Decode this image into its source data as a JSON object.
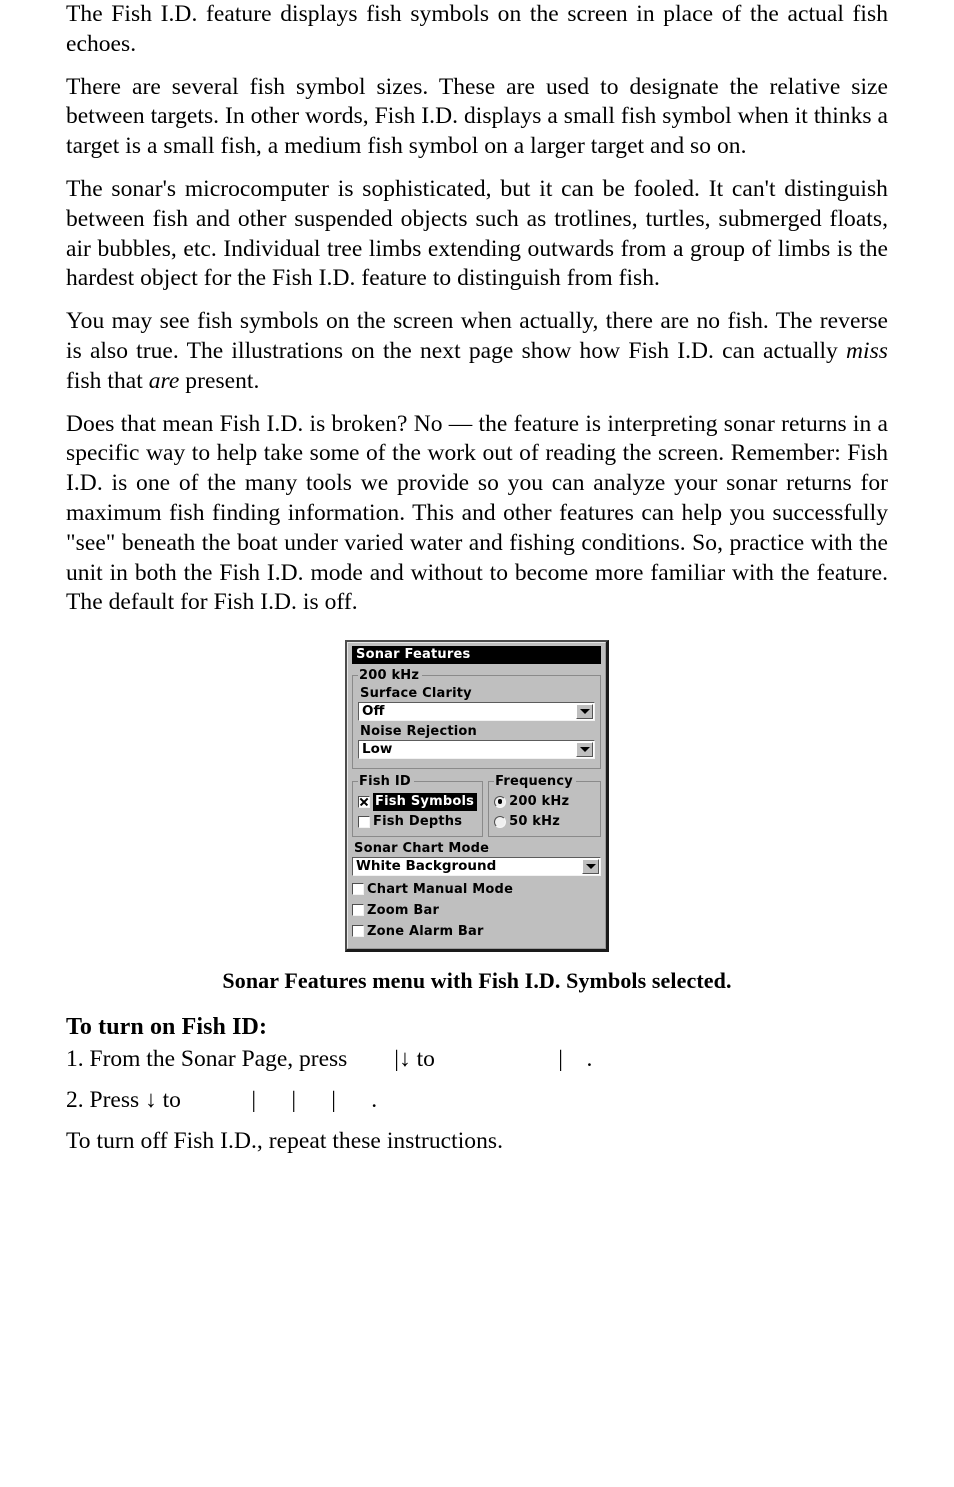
{
  "document": {
    "paragraphs": [
      "The Fish I.D. feature displays fish symbols on the screen in place of the actual fish echoes.",
      "There are several fish symbol sizes. These are used to designate the relative size between targets. In other words, Fish I.D. displays a small fish symbol when it thinks a target is a small fish, a medium fish symbol on a larger target and so on.",
      "The sonar's microcomputer is sophisticated, but it can be fooled. It can't distinguish between fish and other suspended objects such as trotlines, turtles, submerged floats, air bubbles, etc. Individual tree limbs extending outwards from a group of limbs is the hardest object for the Fish I.D. feature to distinguish from fish."
    ],
    "paragraph_4": {
      "part1": "You may see fish symbols on the screen when actually, there are no fish. The reverse is also true. The illustrations on the next page show how Fish I.D. can actually ",
      "italic1": "miss",
      "part2": " fish that ",
      "italic2": "are",
      "part3": " present."
    },
    "paragraph_5": "Does that mean Fish I.D. is broken? No — the feature is interpreting sonar returns in a specific way to help take some of the work out of reading the screen. Remember: Fish I.D. is one of the many tools we provide so you can analyze your sonar returns for maximum fish finding information. This and other features can help you successfully \"see\" beneath the boat under varied water and fishing conditions. So, practice with the unit in both the Fish I.D. mode and without to become more familiar with the feature. The default for Fish I.D. is off.",
    "figure_caption": "Sonar Features menu with Fish I.D. Symbols selected.",
    "instructions_heading": "To turn on Fish ID:",
    "step_1": "1. From the Sonar Page, press        |↓ to                     |    .",
    "step_2": "2. Press ↓ to            |      |      |      .",
    "closing": "To turn off Fish I.D., repeat these instructions."
  },
  "dialog": {
    "title": "Sonar Features",
    "group_200khz": {
      "legend": "200 kHz",
      "surface_clarity": {
        "label": "Surface Clarity",
        "value": "Off"
      },
      "noise_rejection": {
        "label": "Noise Rejection",
        "value": "Low"
      }
    },
    "group_fish_id": {
      "legend": "Fish ID",
      "options": [
        {
          "label": "Fish Symbols",
          "checked": true,
          "highlighted": true
        },
        {
          "label": "Fish Depths",
          "checked": false,
          "highlighted": false
        }
      ]
    },
    "group_frequency": {
      "legend": "Frequency",
      "options": [
        {
          "label": "200 kHz",
          "selected": true
        },
        {
          "label": "50 kHz",
          "selected": false
        }
      ]
    },
    "sonar_chart_mode": {
      "label": "Sonar Chart Mode",
      "value": "White Background"
    },
    "bottom_checkboxes": [
      {
        "label": "Chart Manual Mode",
        "checked": false
      },
      {
        "label": "Zoom Bar",
        "checked": false
      },
      {
        "label": "Zone Alarm Bar",
        "checked": false
      }
    ],
    "colors": {
      "face": "#bfbfbf",
      "titlebar": "#000000",
      "titlebar_text": "#ffffff",
      "field_background": "#ffffff",
      "highlight": "#000000"
    }
  }
}
